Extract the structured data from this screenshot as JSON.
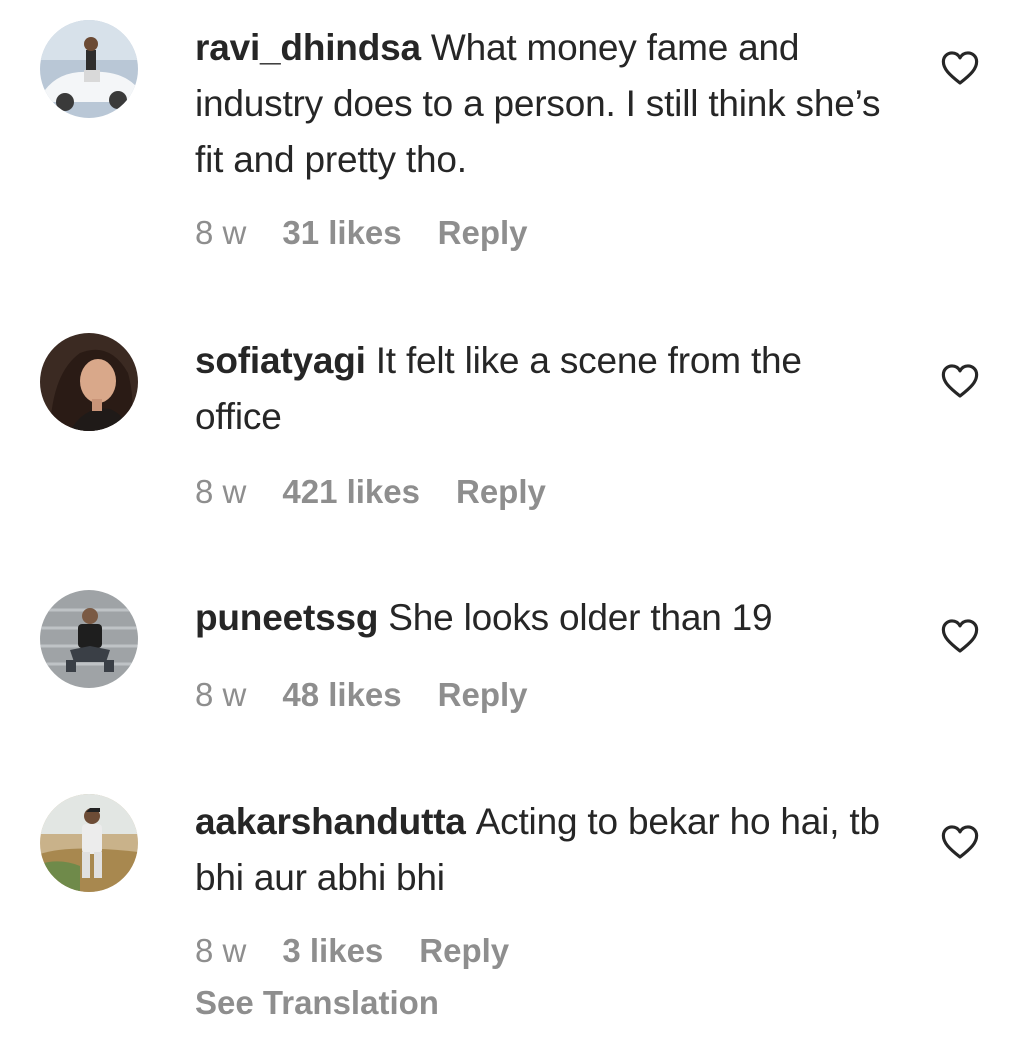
{
  "comments": [
    {
      "username": "ravi_dhindsa",
      "text": "What money fame and industry does to a person. I still think she’s fit and pretty tho.",
      "time": "8 w",
      "likes": "31 likes",
      "reply": "Reply"
    },
    {
      "username": "sofiatyagi",
      "text": "It felt like a scene from the office",
      "time": "8 w",
      "likes": "421 likes",
      "reply": "Reply"
    },
    {
      "username": "puneetssg",
      "text": "She looks older than 19",
      "time": "8 w",
      "likes": "48 likes",
      "reply": "Reply"
    },
    {
      "username": "aakarshandutta",
      "text": "Acting to bekar ho hai, tb bhi aur abhi bhi",
      "time": "8 w",
      "likes": "3 likes",
      "reply": "Reply",
      "see_translation": "See Translation"
    }
  ],
  "icons": {
    "like": "heart-outline-icon"
  },
  "colors": {
    "text": "#262626",
    "secondary": "#8e8e8e",
    "background": "#ffffff"
  }
}
